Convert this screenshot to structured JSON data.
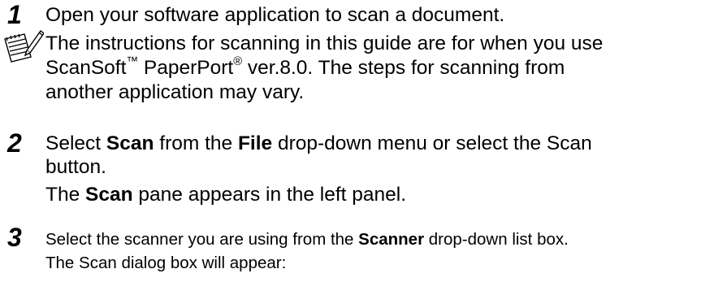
{
  "steps": [
    {
      "number": "1",
      "text": "Open your software application to scan a document."
    },
    {
      "number": "2",
      "line1_pre": "Select ",
      "line1_b1": "Scan",
      "line1_mid": " from the ",
      "line1_b2": "File",
      "line1_post": " drop-down menu or select the Scan",
      "line2": "button.",
      "line3_pre": "The ",
      "line3_b": "Scan",
      "line3_post": " pane appears in the left panel."
    },
    {
      "number": "3",
      "line1_pre": "Select the scanner you are using from the ",
      "line1_b": "Scanner",
      "line1_post": " drop-down list box.",
      "line2": "The Scan dialog box will appear:"
    }
  ],
  "note": {
    "icon": "note-pencil-icon",
    "line1": "The instructions for scanning in this guide are for when you use",
    "line2_a": "ScanSoft",
    "line2_tm": "™",
    "line2_b": " PaperPort",
    "line2_reg": "®",
    "line2_c": " ver.8.0. The steps for scanning from",
    "line3": "another application may vary."
  }
}
